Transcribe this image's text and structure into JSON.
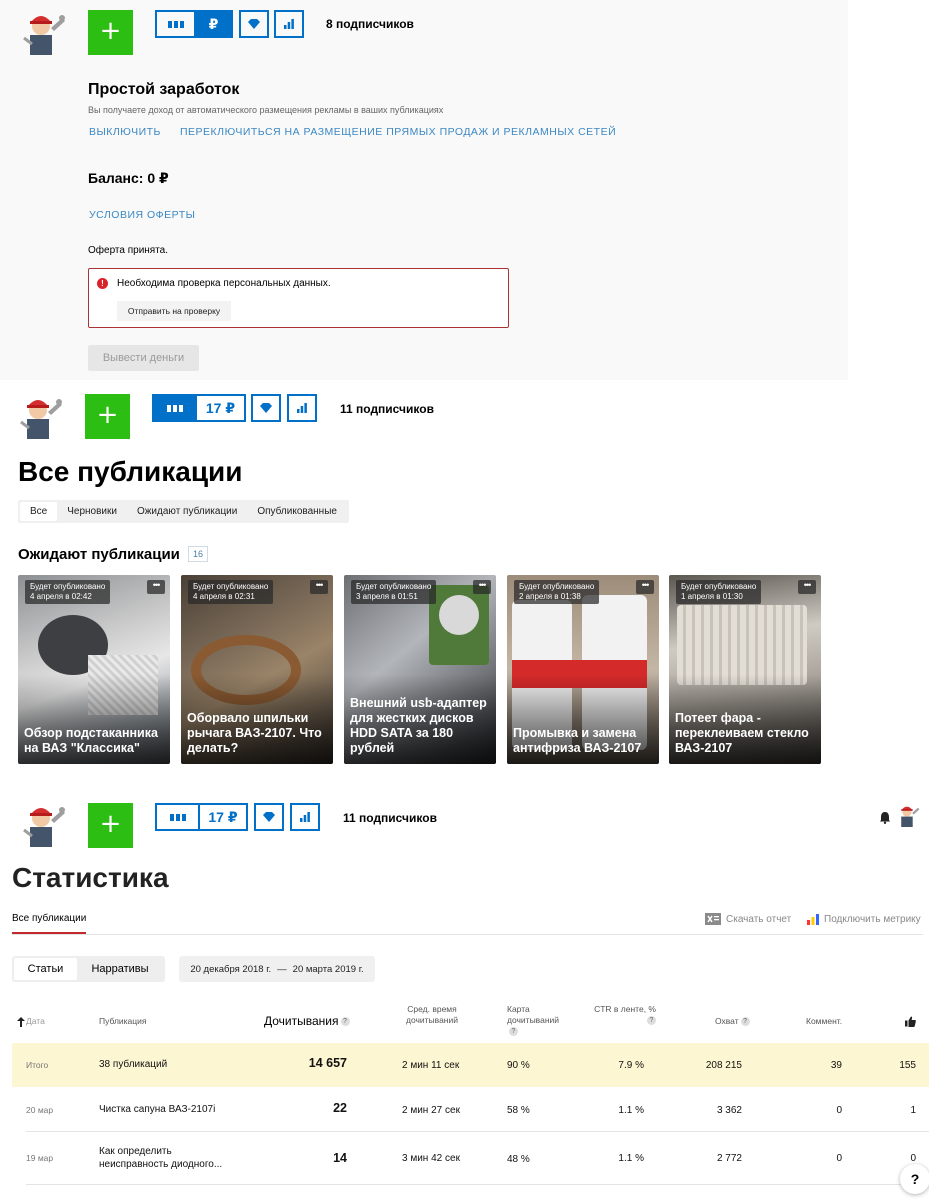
{
  "colors": {
    "accent": "#0070c9",
    "green": "#2dbe14",
    "error": "#d8232a",
    "link": "#3b88c4",
    "total_row": "#fdf6d2"
  },
  "panel1": {
    "header": {
      "balance_label": "₽",
      "subscribers": "8 подписчиков"
    },
    "title": "Простой заработок",
    "description": "Вы получаете доход от автоматического размещения рекламы в ваших публикациях",
    "link_disable": "ВЫКЛЮЧИТЬ",
    "link_switch": "ПЕРЕКЛЮЧИТЬСЯ НА РАЗМЕЩЕНИЕ ПРЯМЫХ ПРОДАЖ И РЕКЛАМНЫХ СЕТЕЙ",
    "balance": "Баланс: 0 ₽",
    "offer_link": "УСЛОВИЯ ОФЕРТЫ",
    "offer_status": "Оферта принята.",
    "alert_text": "Необходима проверка персональных данных.",
    "alert_button": "Отправить на проверку",
    "withdraw_button": "Вывести деньги"
  },
  "panel2": {
    "header": {
      "balance_label": "17 ₽",
      "subscribers": "11 подписчиков"
    },
    "title": "Все публикации",
    "tabs": [
      "Все",
      "Черновики",
      "Ожидают публикации",
      "Опубликованные"
    ],
    "section_title": "Ожидают публикации",
    "section_count": "16",
    "cards": [
      {
        "tag1": "Будет опубликовано",
        "tag2": "4 апреля в 02:42",
        "title": "Обзор подстаканника на ВАЗ \"Классика\""
      },
      {
        "tag1": "Будет опубликовано",
        "tag2": "4 апреля в 02:31",
        "title": "Оборвало шпильки рычага ВАЗ-2107. Что делать?"
      },
      {
        "tag1": "Будет опубликовано",
        "tag2": "3 апреля в 01:51",
        "title": "Внешний usb-адаптер для жестких дисков HDD SATA за 180 рублей"
      },
      {
        "tag1": "Будет опубликовано",
        "tag2": "2 апреля в 01:38",
        "title": "Промывка и замена антифриза ВАЗ-2107"
      },
      {
        "tag1": "Будет опубликовано",
        "tag2": "1 апреля в 01:30",
        "title": "Потеет фара - переклеиваем стекло ВАЗ-2107"
      }
    ]
  },
  "panel3": {
    "header": {
      "balance_label": "17 ₽",
      "subscribers": "11 подписчиков"
    },
    "title": "Статистика",
    "tab_all": "Все публикации",
    "download": "Скачать отчет",
    "metrica": "Подключить метрику",
    "seg": [
      "Статьи",
      "Нарративы"
    ],
    "date_from": "20 декабря 2018 г.",
    "date_sep": "—",
    "date_to": "20 марта 2019 г.",
    "columns": {
      "date": "Дата",
      "publication": "Публикация",
      "readthrough": "Дочитывания",
      "avg_time": "Сред. время дочитываний",
      "map": "Карта дочитываний",
      "ctr": "CTR в ленте, %",
      "reach": "Охват",
      "comments": "Коммент."
    },
    "total": {
      "date": "Итого",
      "pub": "38 публикаций",
      "reads": "14 657",
      "time": "2 мин 11 сек",
      "map": "90 %",
      "ctr": "7.9 %",
      "reach": "208 215",
      "comments": "39",
      "likes": "155"
    },
    "rows": [
      {
        "date": "20 мар",
        "pub": "Чистка сапуна ВАЗ-2107i",
        "reads": "22",
        "time": "2 мин 27 сек",
        "map": "58 %",
        "ctr": "1.1 %",
        "reach": "3 362",
        "comments": "0",
        "likes": "1"
      },
      {
        "date": "19 мар",
        "pub": "Как определить неисправность диодного...",
        "reads": "14",
        "time": "3 мин 42 сек",
        "map": "48 %",
        "ctr": "1.1 %",
        "reach": "2 772",
        "comments": "0",
        "likes": "0"
      }
    ],
    "help": "?"
  },
  "icons": {
    "avatar": "mechanic-avatar-icon",
    "plus": "plus-icon",
    "feed": "feed-bars-icon",
    "diamond": "diamond-icon",
    "stats": "stats-chart-icon",
    "bell": "bell-icon",
    "sort": "sort-arrow-icon",
    "like": "thumbs-up-icon",
    "excel": "excel-icon",
    "metrica": "metrica-icon",
    "alert": "alert-icon"
  }
}
